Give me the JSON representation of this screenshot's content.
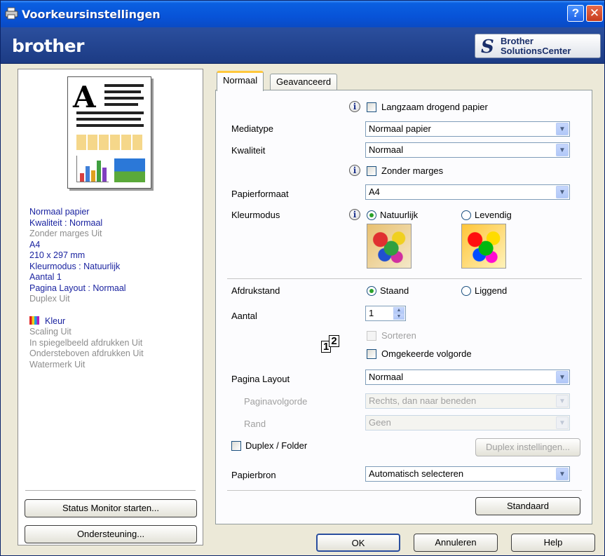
{
  "window": {
    "title": "Voorkeursinstellingen",
    "help_glyph": "?",
    "close_glyph": "✕"
  },
  "banner": {
    "logo": "brother",
    "solutions_line1": "Brother",
    "solutions_line2": "SolutionsCenter"
  },
  "summary": {
    "items": [
      {
        "text": "Normaal papier",
        "state": "active"
      },
      {
        "text": "Kwaliteit : Normaal",
        "state": "active"
      },
      {
        "text": "Zonder marges Uit",
        "state": "inactive"
      },
      {
        "text": "A4",
        "state": "active"
      },
      {
        "text": "210 x 297 mm",
        "state": "active"
      },
      {
        "text": "Kleurmodus : Natuurlijk",
        "state": "active"
      },
      {
        "text": "Aantal 1",
        "state": "active"
      },
      {
        "text": "Pagina Layout : Normaal",
        "state": "active"
      },
      {
        "text": "Duplex Uit",
        "state": "inactive"
      }
    ],
    "kleur": "Kleur",
    "extra": [
      "Scaling Uit",
      "In spiegelbeeld afdrukken Uit",
      "Ondersteboven afdrukken Uit",
      "Watermerk Uit"
    ],
    "status_monitor_button": "Status Monitor starten...",
    "support_button": "Ondersteuning..."
  },
  "tabs": [
    {
      "label": "Normaal",
      "active": true
    },
    {
      "label": "Geavanceerd",
      "active": false
    }
  ],
  "form": {
    "slow_dry": {
      "label": "Langzaam drogend papier",
      "checked": false
    },
    "media_type": {
      "label": "Mediatype",
      "value": "Normaal papier"
    },
    "quality": {
      "label": "Kwaliteit",
      "value": "Normaal"
    },
    "borderless": {
      "label": "Zonder marges",
      "checked": false
    },
    "paper_size": {
      "label": "Papierformaat",
      "value": "A4"
    },
    "color_mode": {
      "label": "Kleurmodus",
      "option1": "Natuurlijk",
      "option2": "Levendig",
      "selected": "Natuurlijk"
    },
    "orientation": {
      "label": "Afdrukstand",
      "option1": "Staand",
      "option2": "Liggend",
      "selected": "Staand"
    },
    "copies": {
      "label": "Aantal",
      "value": "1"
    },
    "collate": {
      "label": "Sorteren",
      "checked": false,
      "enabled": false
    },
    "reverse_order": {
      "label": "Omgekeerde volgorde",
      "checked": false
    },
    "page_layout": {
      "label": "Pagina Layout",
      "value": "Normaal"
    },
    "page_order": {
      "label": "Paginavolgorde",
      "value": "Rechts, dan naar beneden",
      "enabled": false
    },
    "border": {
      "label": "Rand",
      "value": "Geen",
      "enabled": false
    },
    "duplex": {
      "label": "Duplex / Folder",
      "checked": false
    },
    "duplex_settings_button": "Duplex instellingen...",
    "paper_source": {
      "label": "Papierbron",
      "value": "Automatisch selecteren"
    },
    "default_button": "Standaard"
  },
  "footer": {
    "ok": "OK",
    "cancel": "Annuleren",
    "help": "Help"
  }
}
